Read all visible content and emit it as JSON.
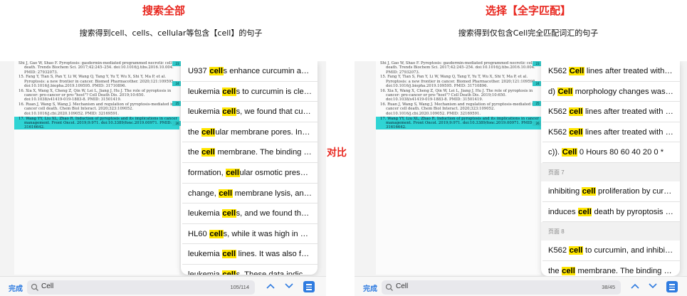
{
  "left": {
    "title": "搜索全部",
    "subtitle": "搜索得到cell、cells、cellular等包含【cell】的句子",
    "search": {
      "done_label": "完成",
      "query": "Cell",
      "count": "105/114"
    },
    "results": [
      {
        "before": "U937 ",
        "match": "cell",
        "after": "s enhance curcumin anti-l..."
      },
      {
        "before": "leukemia ",
        "match": "cell",
        "after": "s to curcumin is clearly..."
      },
      {
        "before": "leukemia ",
        "match": "cell",
        "after": "s, we found that curcu..."
      },
      {
        "before": "the ",
        "match": "cell",
        "after": "ular membrane pores. In res..."
      },
      {
        "before": "the ",
        "match": "cell",
        "after": " membrane. The binding cou..."
      },
      {
        "before": "formation, ",
        "match": "cell",
        "after": "ular osmotic pressure..."
      },
      {
        "before": "change, ",
        "match": "cell",
        "after": " membrane lysis, and p..."
      },
      {
        "before": "leukemia ",
        "match": "cell",
        "after": "s, and we found that G..."
      },
      {
        "before": "HL60 ",
        "match": "cell",
        "after": "s, while it was high in curc..."
      },
      {
        "before": "leukemia ",
        "match": "cell",
        "after": " lines. It was also foun..."
      },
      {
        "before": "leukemia ",
        "match": "cell",
        "after": "s. These data indicate..."
      }
    ],
    "doc_refs": [
      "Shi J, Gao W, Shao F. Pyroptosis: gasdermin-mediated programmed necrotic cell death. Trends Biochem Sci. 2017;42:245–254. doi:10.1016/j.tibs.2016.10.004. PMID: 27932073.",
      "15. Fang Y, Tian S, Pan Y, Li W, Wang Q, Tang Y, Yu T, Wu X, Shi Y, Ma P, et al. Pyroptosis: a new frontier in cancer. Biomed Pharmacother. 2020;121:109595. doi:10.1016/j.biopha.2019.109595. PMID: 31710896.",
      "16. Xia X, Wang X, Cheng Z, Qin W, Lei L, Jiang J, Hu J. The role of pyroptosis in cancer: pro-cancer or pro-\"host\"? Cell Death Dis. 2019;10:650. doi:10.1038/s41419-019-1883-8. PMID: 31501419.",
      "16. Ruan J, Wang S, Wang J. Mechanism and regulation of pyroptosis-mediated in cancer cell death. Chem Biol Interact. 2020;323:109052. doi:10.1016/j.cbi.2020.109052. PMID: 32169591.",
      "17. Wang YY, Liu XL, Zhao R. Induction of pyroptosis and its implications in cancer management. Front Oncol. 2019;9:971. doi:10.3389/fonc.2019.00971. PMID: 31616642."
    ],
    "thumbs": [
      "23",
      "24",
      "25",
      "26",
      "27"
    ]
  },
  "right": {
    "title": "选择【全字匹配】",
    "subtitle": "搜索得到仅包含Cell完全匹配词汇的句子",
    "search": {
      "done_label": "完成",
      "query": "Cell",
      "count": "38/45"
    },
    "group1": [
      {
        "before": "K562 ",
        "match": "Cell",
        "after": " lines after treated with cu..."
      },
      {
        "before": "d) ",
        "match": "Cell",
        "after": " morphology changes was an..."
      },
      {
        "before": "K562 ",
        "match": "cell",
        "after": " lines after treated with cu..."
      },
      {
        "before": "K562 ",
        "match": "cell",
        "after": " lines after treated with cu..."
      },
      {
        "before": "c)). ",
        "match": "Cell",
        "after": " 0 Hours 80 60 40 20 0 *"
      }
    ],
    "page7": "页面 7",
    "group2": [
      {
        "before": "inhibiting ",
        "match": "cell",
        "after": " proliferation by curcu..."
      },
      {
        "before": "induces ",
        "match": "cell",
        "after": " death by pyroptosis in..."
      }
    ],
    "page8": "页面 8",
    "group3": [
      {
        "before": "K562 ",
        "match": "cell",
        "after": " to curcumin, and inhibitio..."
      },
      {
        "before": "the ",
        "match": "cell",
        "after": " membrane. The binding cou..."
      }
    ]
  },
  "vs_label": "对比",
  "colors": {
    "accent": "#e8271f",
    "link": "#2e7be0",
    "match_highlight": "#ffe500",
    "doc_highlight": "#2fd4d4"
  },
  "icons": [
    "search-icon",
    "chevron-up-icon",
    "chevron-down-icon",
    "list-icon"
  ]
}
